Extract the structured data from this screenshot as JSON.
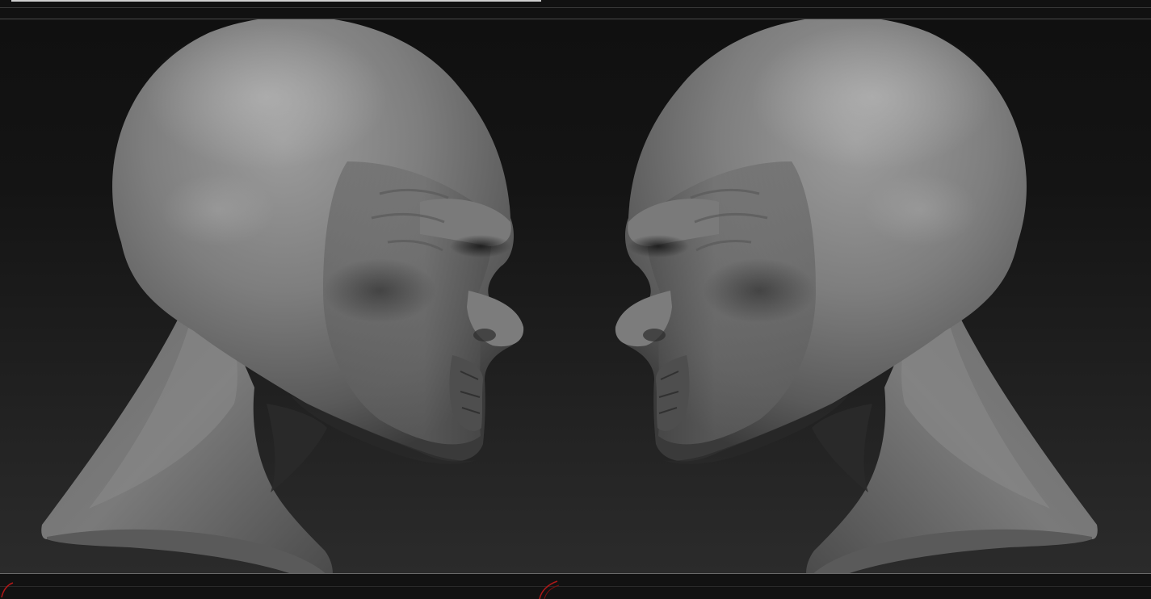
{
  "app": {
    "accent": "#b01818",
    "background": "#0d0d0d"
  },
  "top_bar": {
    "progress_fraction": 0.46
  },
  "viewport": {
    "content": "two-sculpted-heads-facing",
    "model_color": "#8a8a8a"
  },
  "bottom_bar": {
    "icons": [
      "red-arc-icon",
      "red-arc-icon"
    ]
  }
}
